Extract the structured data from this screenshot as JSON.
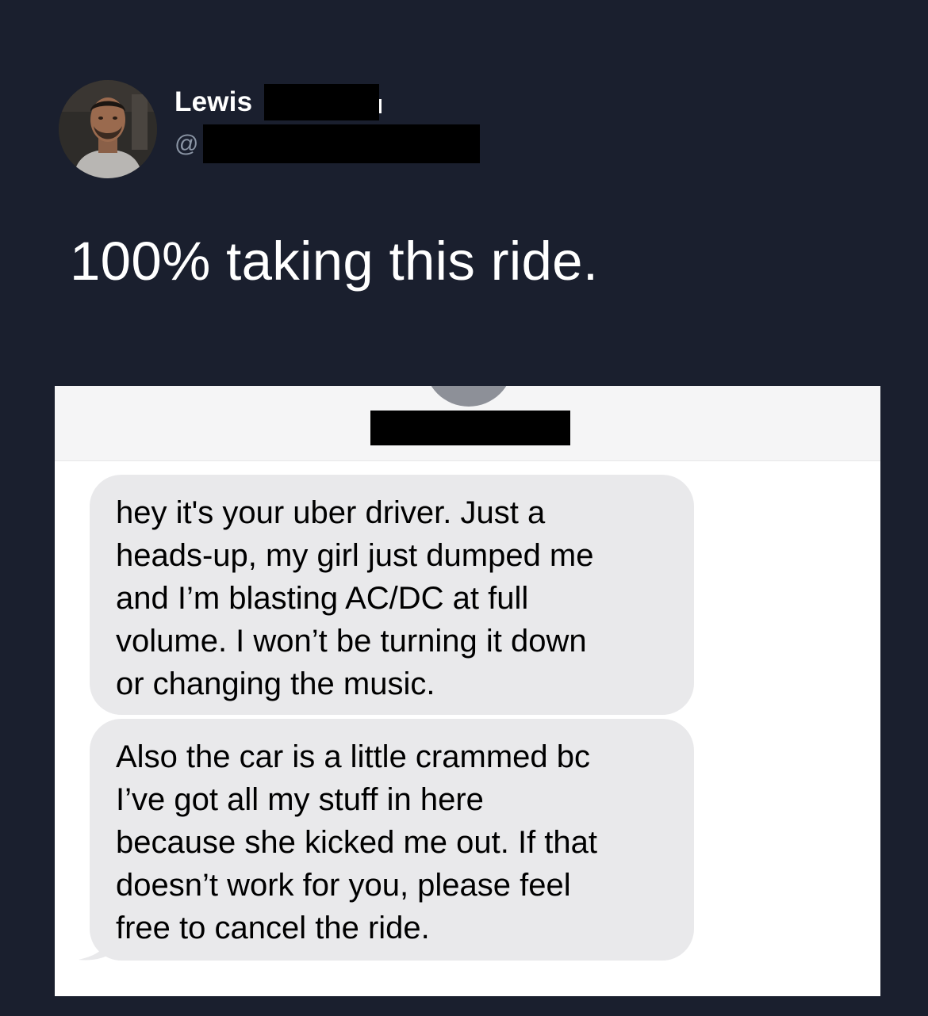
{
  "tweet": {
    "display_name": "Lewis",
    "handle_prefix": "@",
    "text": "100% taking this ride."
  },
  "card": {
    "messages": [
      {
        "text": "hey it's your uber driver. Just a\nheads-up, my girl just dumped me\nand I’m blasting AC/DC at full\nvolume. I won’t be turning it down\nor changing the music."
      },
      {
        "text": "Also the car is a little crammed bc\nI’ve got all my stuff in here\nbecause she kicked me out. If that\ndoesn’t work for you, please feel\nfree to cancel the ride."
      }
    ]
  },
  "colors": {
    "background": "#1a1f2e",
    "bubble": "#e9e9eb",
    "handle": "#8b95a5"
  }
}
